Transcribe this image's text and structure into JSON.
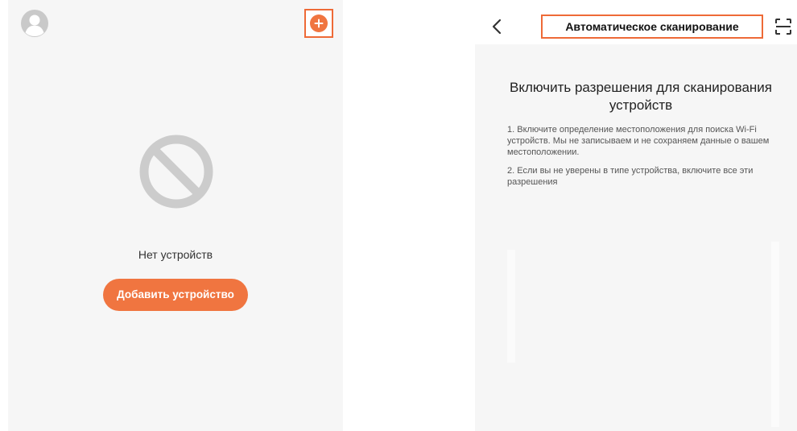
{
  "left_screen": {
    "empty_message": "Нет устройств",
    "add_device_label": "Добавить устройство"
  },
  "right_screen": {
    "title": "Автоматическое сканирование",
    "heading": "Включить разрешения для сканирования устройств",
    "instructions": [
      "1. Включите определение местоположения для поиска Wi-Fi устройств. Мы не записываем и не сохраняем данные о вашем местоположении.",
      "2. Если вы не уверены в типе устройства, включите все эти разрешения"
    ]
  },
  "colors": {
    "accent": "#f07540",
    "highlight_border": "#ee6a37",
    "screen_background": "#f6f6f6",
    "icon_gray": "#cccccc"
  },
  "icons": {
    "profile": "avatar-icon",
    "add": "plus-circle-icon",
    "empty_state": "no-entry-icon",
    "back": "chevron-left-icon",
    "scan": "scan-icon"
  }
}
